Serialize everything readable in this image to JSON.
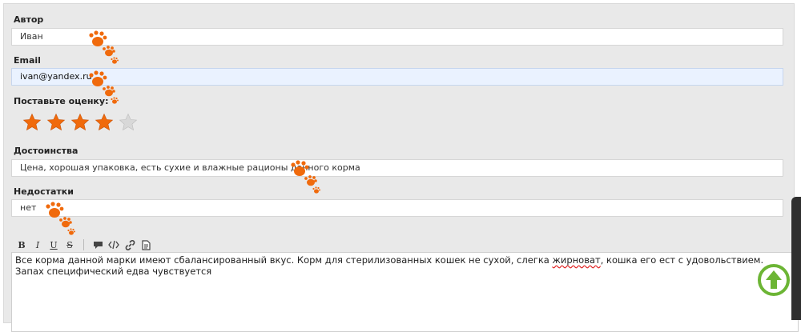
{
  "form": {
    "author_label": "Автор",
    "author_value": "Иван",
    "email_label": "Email",
    "email_value": "ivan@yandex.ru",
    "rating_label": "Поставьте оценку:",
    "rating": {
      "value": 4,
      "max": 5
    },
    "pros_label": "Достоинства",
    "pros_value": "Цена, хорошая упаковка, есть сухие и влажные рационы данного корма",
    "cons_label": "Недостатки",
    "cons_value": "нет"
  },
  "toolbar": {
    "bold": "B",
    "italic": "I",
    "underline": "U",
    "strike": "S"
  },
  "editor": {
    "text_before": "Все корма данной марки имеют сбалансированный вкус. Корм для стерилизованных кошек не сухой, слегка ",
    "misspelled": "жирноват",
    "text_after": ", кошка его ест с удовольствием. Запах специфический едва чувствуется"
  },
  "colors": {
    "star_on": "#f06a0c",
    "star_off": "#d8d8d8",
    "paw": "#f06a0c",
    "scroll_up": "#6cb535",
    "focused_field": "#eaf2ff"
  },
  "icons": {
    "paw": "paw-print-icon",
    "scroll_up": "arrow-up-icon",
    "quote": "speech-bubble-icon",
    "code": "code-icon",
    "link": "link-icon",
    "file": "document-icon"
  }
}
